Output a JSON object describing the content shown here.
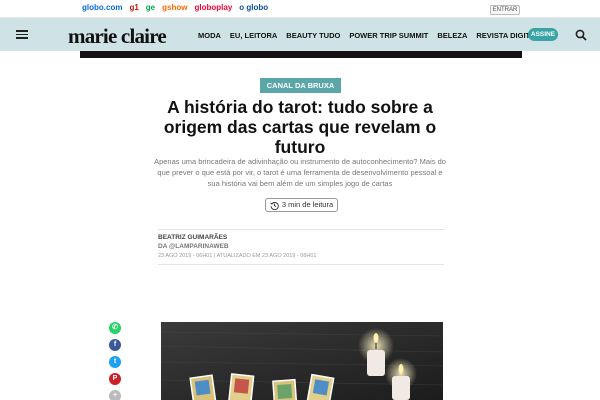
{
  "globo_bar": {
    "links": [
      {
        "label": "globo.com",
        "color": "#0669de"
      },
      {
        "label": "g1",
        "color": "#c4170c"
      },
      {
        "label": "ge",
        "color": "#06aa48"
      },
      {
        "label": "gshow",
        "color": "#ff6a00"
      },
      {
        "label": "globoplay",
        "color": "#fb0234"
      },
      {
        "label": "o globo",
        "color": "#0b4da2"
      }
    ],
    "login_label": "ENTRAR"
  },
  "header": {
    "logo": "marie claire",
    "nav": [
      "MODA",
      "EU, LEITORA",
      "BEAUTY TUDO",
      "POWER TRIP SUMMIT",
      "BELEZA",
      "REVISTA DIGITAL"
    ],
    "subscribe_label": "ASSINE",
    "accent": "#cfe3e6"
  },
  "article": {
    "category": "CANAL DA BRUXA",
    "title": "A história do tarot: tudo sobre a origem das cartas que revelam o futuro",
    "subtitle": "Apenas uma brincadeira de adivinhação ou instrumento de autoconhecimento? Mais do que prever o que está por vir, o tarot é uma ferramenta de desenvolvimento pessoal e sua história vai bem além de um simples jogo de cartas",
    "read_time": "3 min de leitura",
    "author": "BEATRIZ GUIMARÃES",
    "author_source": "DA @LAMPARINAWEB",
    "dates": "23 AGO 2019 - 06H01 | ATUALIZADO EM 23 AGO 2019 - 06H01"
  },
  "share": [
    {
      "icon": "whatsapp-icon",
      "glyph": "✆",
      "color": "#25d366"
    },
    {
      "icon": "facebook-icon",
      "glyph": "f",
      "color": "#3b5998"
    },
    {
      "icon": "twitter-icon",
      "glyph": "t",
      "color": "#1da1f2"
    },
    {
      "icon": "pinterest-icon",
      "glyph": "P",
      "color": "#cb2027"
    },
    {
      "icon": "more-icon",
      "glyph": "+",
      "color": "#bbbbbb"
    }
  ]
}
